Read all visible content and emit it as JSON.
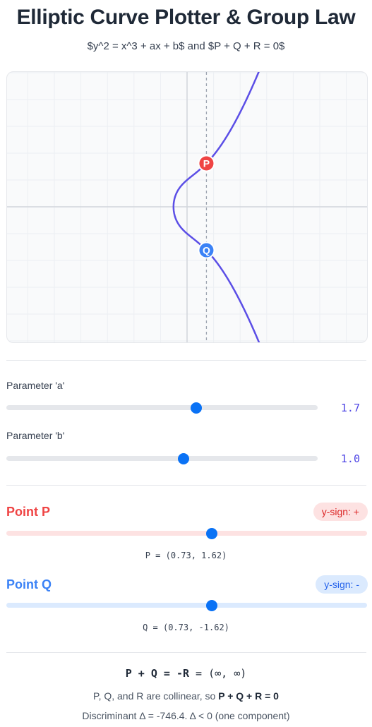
{
  "header": {
    "title": "Elliptic Curve Plotter & Group Law",
    "subtitle": "$y^2 = x^3 + ax + b$ and $P + Q + R = 0$"
  },
  "colors": {
    "curve": "#5b4ee6",
    "point_p": "#ef4444",
    "point_q": "#3b82f6",
    "slider_thumb": "#0a72f5",
    "accent_value": "#4f46e5"
  },
  "params": {
    "a": {
      "label": "Parameter 'a'",
      "value": "1.7",
      "level": 0.61
    },
    "b": {
      "label": "Parameter 'b'",
      "value": "1.0",
      "level": 0.57
    }
  },
  "points": {
    "p": {
      "title": "Point P",
      "sign_badge": "y-sign: +",
      "coord_text": "P = (0.73, 1.62)",
      "marker": "P",
      "level": 0.57
    },
    "q": {
      "title": "Point Q",
      "sign_badge": "y-sign: -",
      "coord_text": "Q = (0.73, -1.62)",
      "marker": "Q",
      "level": 0.57
    }
  },
  "result": {
    "lhs": "P + Q = -R",
    "equals": "=",
    "rhs": "(∞, ∞)",
    "collinear_prefix": "P, Q, and R are collinear, so",
    "collinear_bold": "P + Q + R = 0",
    "discriminant_text": "Discriminant Δ = -746.4. Δ < 0 (one component)"
  },
  "chart_data": {
    "type": "line",
    "curve": "y^2 = x^3 + 1.7x + 1.0",
    "a": 1.7,
    "b": 1.0,
    "xlim": [
      -5,
      5
    ],
    "ylim": [
      -5,
      5
    ],
    "grid": true,
    "points": [
      {
        "name": "P",
        "x": 0.73,
        "y": 1.62
      },
      {
        "name": "Q",
        "x": 0.73,
        "y": -1.62
      }
    ],
    "vertical_line_x": 0.73
  }
}
